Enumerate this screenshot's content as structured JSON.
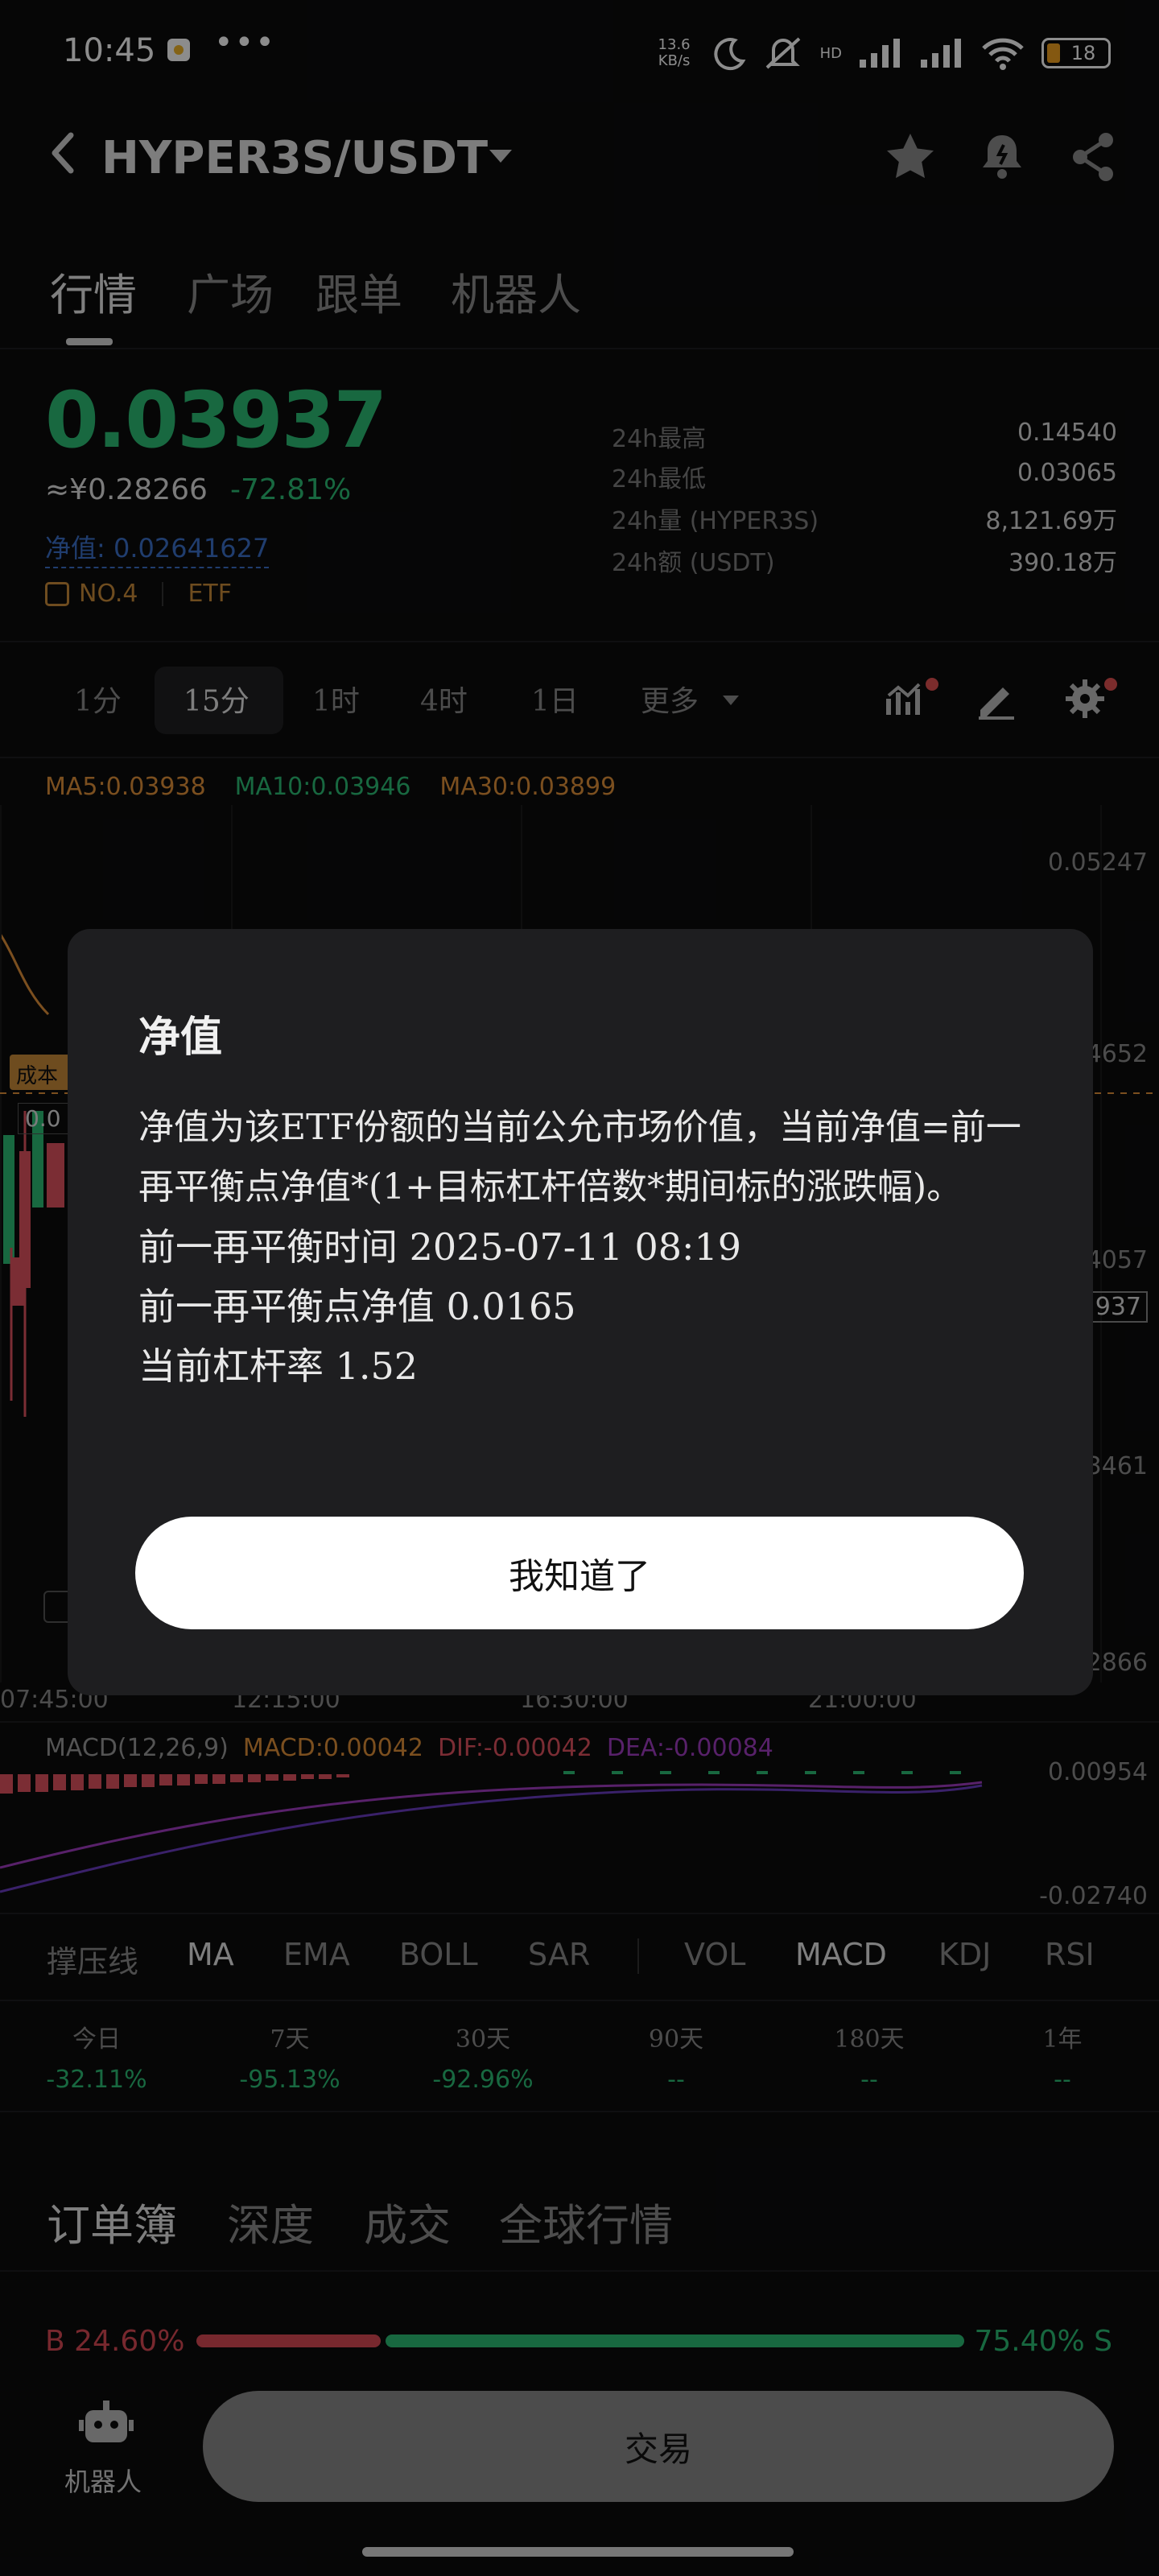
{
  "status_bar": {
    "time": "10:45",
    "more": "•••",
    "net_speed": "13.6 KB/s",
    "hd": "HD",
    "battery": "18"
  },
  "header": {
    "pair": "HYPER3S/USDT"
  },
  "tabs": [
    "行情",
    "广场",
    "跟单",
    "机器人"
  ],
  "price": {
    "last": "0.03937",
    "cny": "≈¥0.28266",
    "change": "-72.81%",
    "nav": "净值: 0.02641627",
    "rank": "NO.4",
    "tag": "ETF"
  },
  "stats": [
    {
      "k": "24h最高",
      "v": "0.14540"
    },
    {
      "k": "24h最低",
      "v": "0.03065"
    },
    {
      "k": "24h量 (HYPER3S)",
      "v": "8,121.69万"
    },
    {
      "k": "24h额 (USDT)",
      "v": "390.18万"
    }
  ],
  "intervals": [
    "1分",
    "15分",
    "1时",
    "4时",
    "1日",
    "更多"
  ],
  "ma": {
    "ma5": "MA5:0.03938",
    "ma10": "MA10:0.03946",
    "ma30": "MA30:0.03899"
  },
  "ma_colors": {
    "ma5": "#e0913a",
    "ma10": "#2dbd76",
    "ma30": "#e0913a"
  },
  "y_axis": [
    "0.05247",
    "4652",
    "4057",
    "937",
    "3461",
    "2866"
  ],
  "x_axis": [
    "07:45:00",
    "12:15:00",
    "16:30:00",
    "21:00:00"
  ],
  "chart_left": {
    "label": "成本",
    "value": "0.0"
  },
  "macd": {
    "label": "MACD(12,26,9)",
    "macd": "MACD:0.00042",
    "dif": "DIF:-0.00042",
    "dea": "DEA:-0.00084",
    "y_top": "0.00954",
    "y_bottom": "-0.02740"
  },
  "indicators": {
    "left": [
      "撑压线",
      "MA",
      "EMA",
      "BOLL",
      "SAR"
    ],
    "right": [
      "VOL",
      "MACD",
      "KDJ",
      "RSI"
    ]
  },
  "performance": [
    {
      "k": "今日",
      "v": "-32.11%"
    },
    {
      "k": "7天",
      "v": "-95.13%"
    },
    {
      "k": "30天",
      "v": "-92.96%"
    },
    {
      "k": "90天",
      "v": "--"
    },
    {
      "k": "180天",
      "v": "--"
    },
    {
      "k": "1年",
      "v": "--"
    }
  ],
  "book_tabs": [
    "订单簿",
    "深度",
    "成交",
    "全球行情"
  ],
  "buy_sell": {
    "buy": "B 24.60%",
    "sell": "75.40% S",
    "buy_ratio": 0.246
  },
  "footer": {
    "robot": "机器人",
    "trade": "交易"
  },
  "modal": {
    "title": "净值",
    "description": "净值为该ETF份额的当前公允市场价值，当前净值=前一再平衡点净值*(1+目标杠杆倍数*期间标的涨跌幅)。",
    "rebalance_time": "前一再平衡时间 2025-07-11 08:19",
    "rebalance_nav": "前一再平衡点净值 0.0165",
    "leverage": "当前杠杆率 1.52",
    "confirm": "我知道了"
  }
}
